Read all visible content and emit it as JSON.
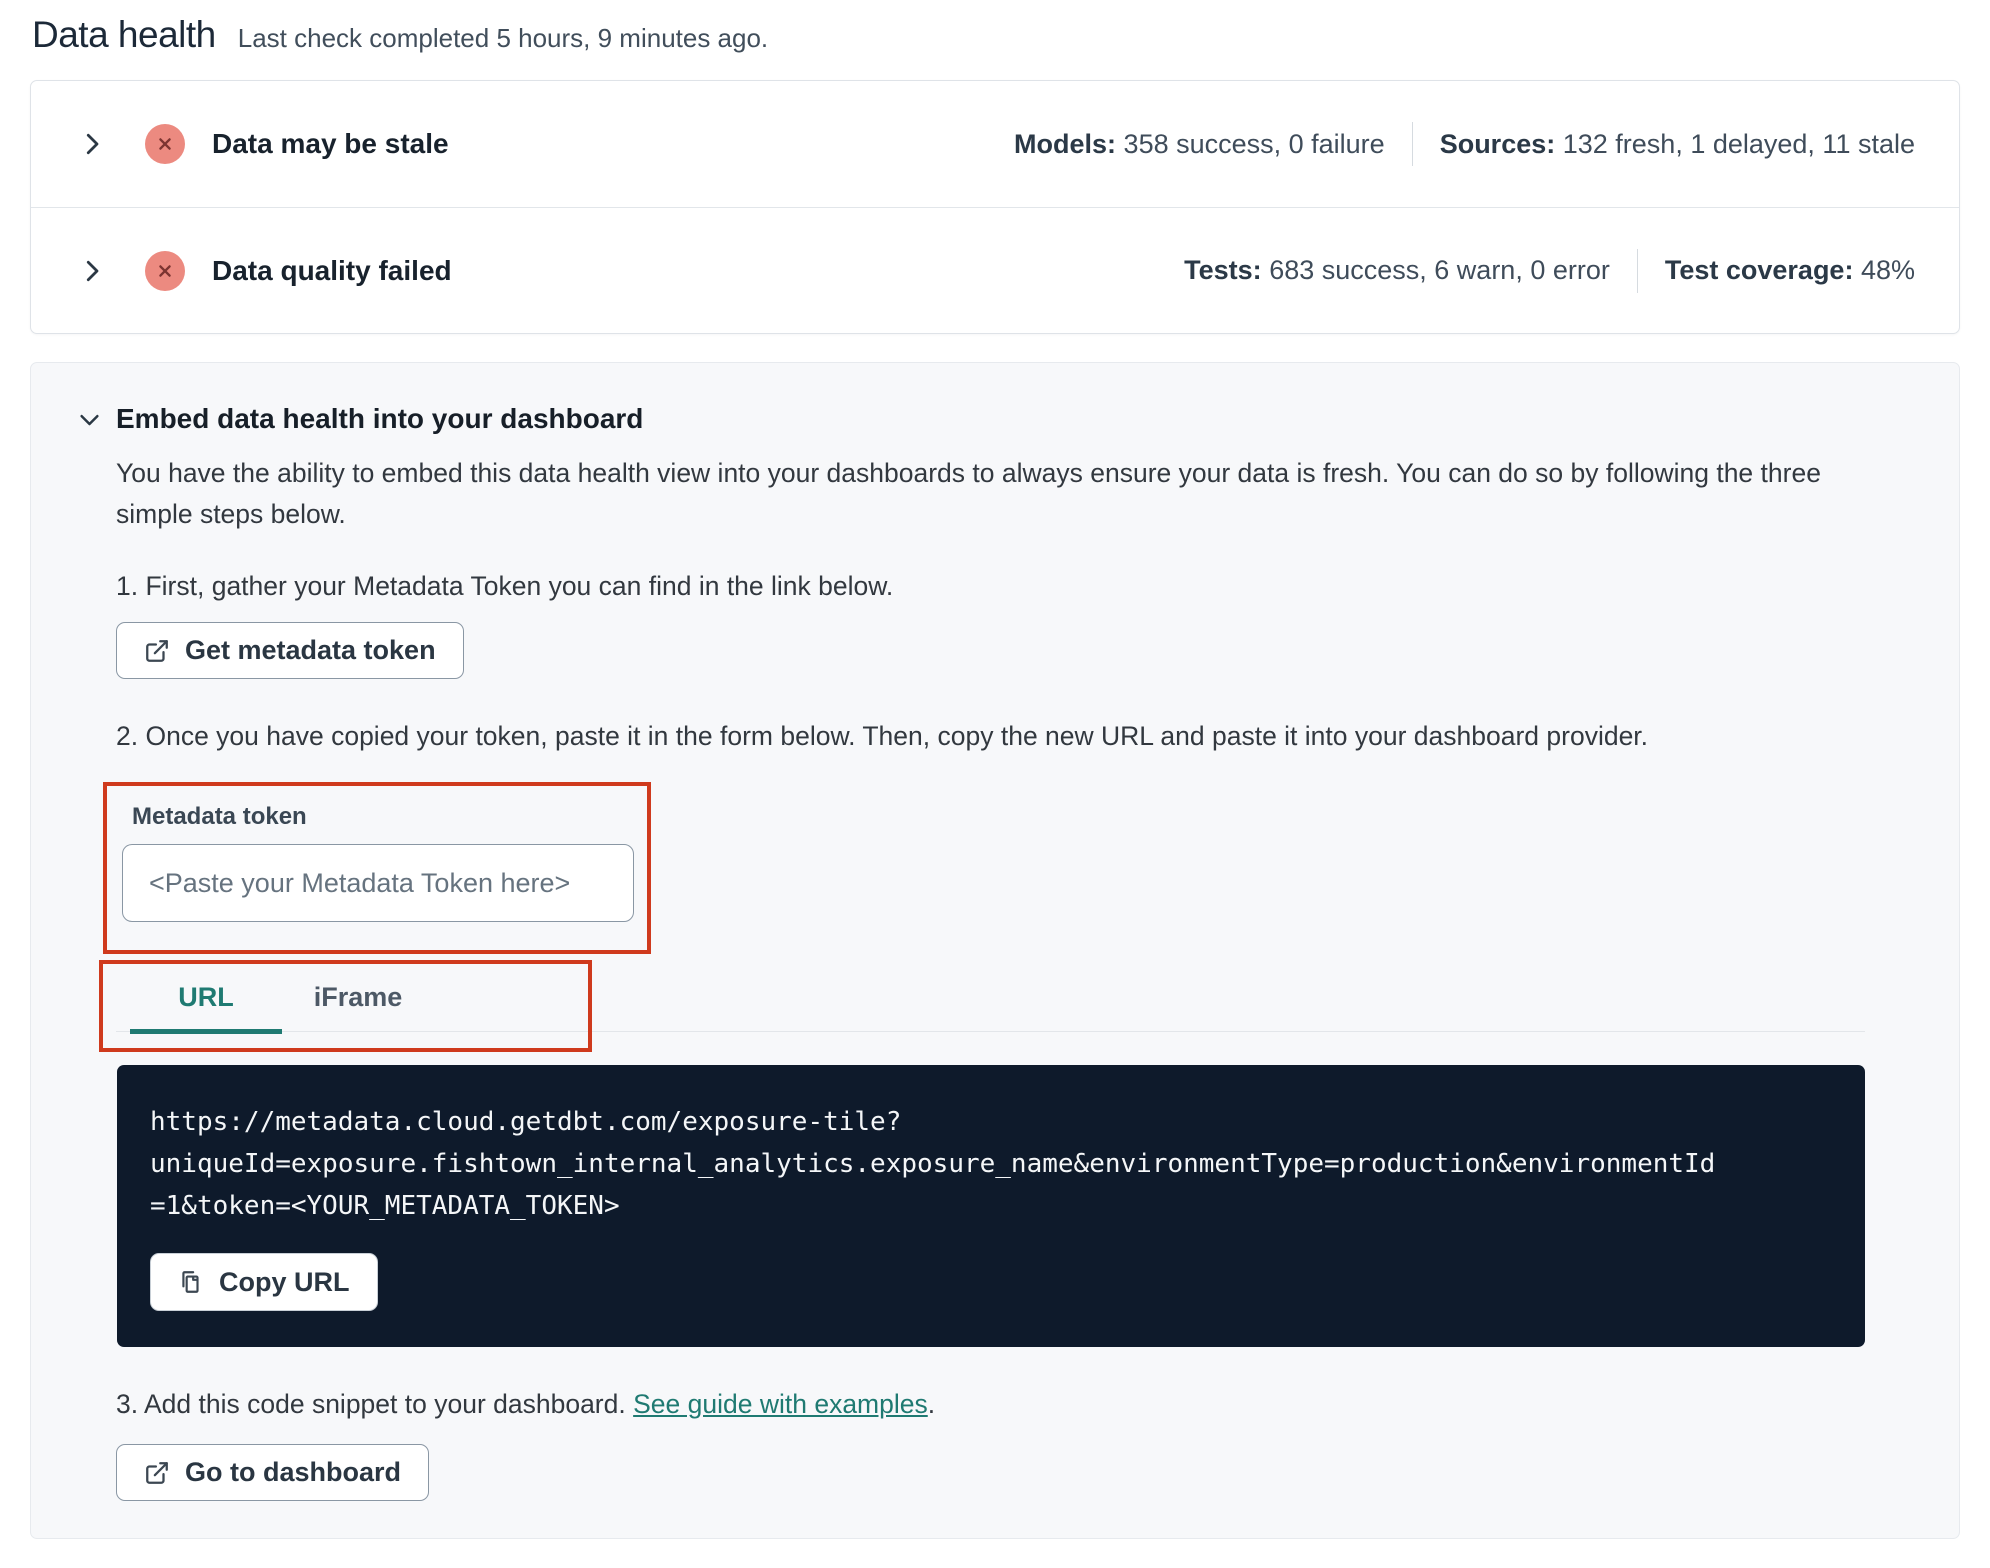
{
  "page": {
    "title": "Data health",
    "subtitle": "Last check completed 5 hours, 9 minutes ago."
  },
  "status_rows": [
    {
      "title": "Data may be stale",
      "status_icon": "error-x-circle",
      "stats": [
        {
          "label": "Models:",
          "value": "358 success, 0 failure"
        },
        {
          "label": "Sources:",
          "value": "132 fresh, 1 delayed, 11 stale"
        }
      ]
    },
    {
      "title": "Data quality failed",
      "status_icon": "error-x-circle",
      "stats": [
        {
          "label": "Tests:",
          "value": "683 success, 6 warn, 0 error"
        },
        {
          "label": "Test coverage:",
          "value": "48%"
        }
      ]
    }
  ],
  "embed": {
    "title": "Embed data health into your dashboard",
    "description": "You have the ability to embed this data health view into your dashboards to always ensure your data is fresh. You can do so by following the three simple steps below.",
    "step1": {
      "text": "1. First, gather your Metadata Token you can find in the link below.",
      "button_label": "Get metadata token",
      "button_icon": "external-link-icon"
    },
    "step2": {
      "text": "2. Once you have copied your token, paste it in the form below. Then, copy the new URL and paste it into your dashboard provider.",
      "token_label": "Metadata token",
      "token_placeholder": "<Paste your Metadata Token here>",
      "tabs": [
        "URL",
        "iFrame"
      ],
      "active_tab": "URL",
      "code_lines": [
        "https://metadata.cloud.getdbt.com/exposure-tile?",
        "uniqueId=exposure.fishtown_internal_analytics.exposure_name&environmentType=production&environmentId",
        "=1&token=<YOUR_METADATA_TOKEN>"
      ],
      "copy_button_label": "Copy URL",
      "copy_button_icon": "copy-icon"
    },
    "step3": {
      "text": "3. Add this code snippet to your dashboard.",
      "link_text": "See guide with examples",
      "suffix": ".",
      "button_label": "Go to dashboard",
      "button_icon": "external-link-icon"
    }
  },
  "colors": {
    "accent_teal": "#1f7a72",
    "annotation_red": "#cf3a1d",
    "error_badge_bg": "#ec8a80",
    "error_badge_x": "#7c3431",
    "code_block_bg": "#0e1a2b",
    "card_border": "#dfe3e8",
    "embed_card_bg": "#f7f8fa"
  }
}
